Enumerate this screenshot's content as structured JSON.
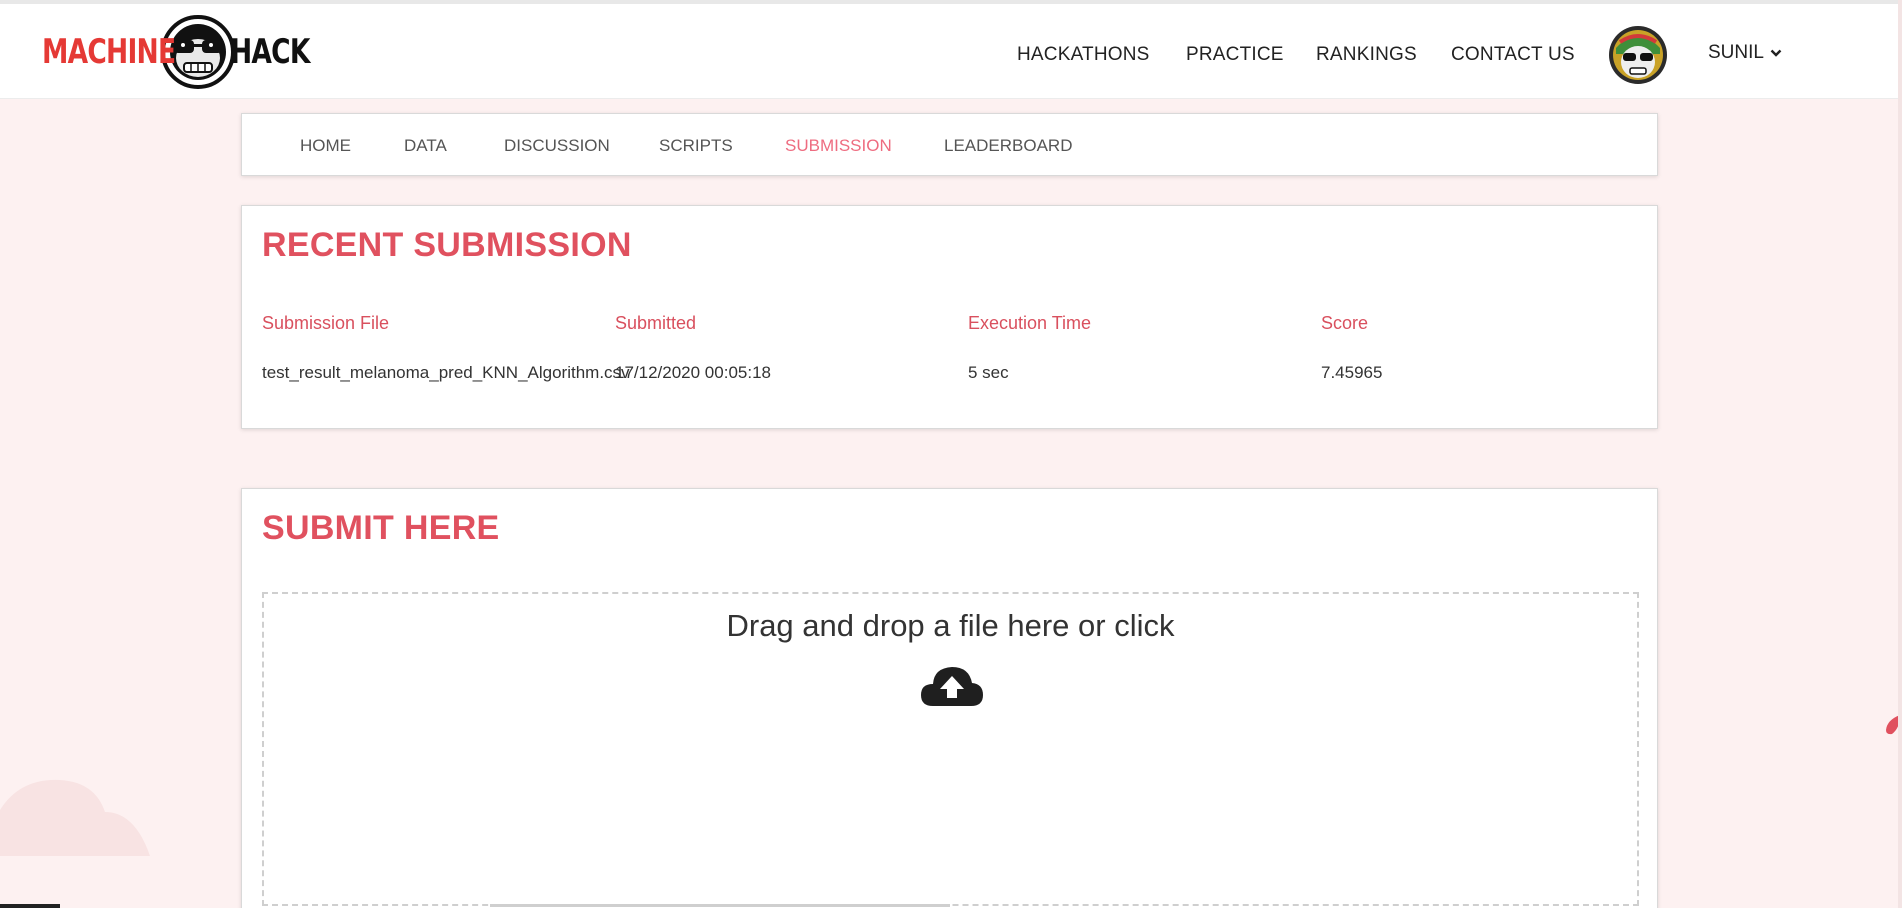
{
  "header": {
    "logo_left": "MACHINE",
    "logo_right": "HACK",
    "nav": [
      {
        "label": "HACKATHONS"
      },
      {
        "label": "PRACTICE"
      },
      {
        "label": "RANKINGS"
      },
      {
        "label": "CONTACT US"
      }
    ],
    "user_name": "SUNIL",
    "user_menu_icon": "chevron-down-icon",
    "avatar_icon": "monkey-astronaut-avatar"
  },
  "tabs": [
    {
      "label": "HOME",
      "active": false
    },
    {
      "label": "DATA",
      "active": false
    },
    {
      "label": "DISCUSSION",
      "active": false
    },
    {
      "label": "SCRIPTS",
      "active": false
    },
    {
      "label": "SUBMISSION",
      "active": true
    },
    {
      "label": "LEADERBOARD",
      "active": false
    }
  ],
  "recent": {
    "title": "RECENT SUBMISSION",
    "columns": [
      "Submission File",
      "Submitted",
      "Execution Time",
      "Score"
    ],
    "rows": [
      [
        "test_result_melanoma_pred_KNN_Algorithm.csv",
        "17/12/2020 00:05:18",
        "5 sec",
        "7.45965"
      ]
    ]
  },
  "submit": {
    "title": "SUBMIT HERE",
    "drop_text": "Drag and drop a file here or click",
    "upload_icon": "cloud-upload-icon"
  },
  "colors": {
    "accent": "#e0515f",
    "active_tab": "#ee6c80",
    "logo_red": "#e53935",
    "page_bg": "#fdf1f1"
  }
}
